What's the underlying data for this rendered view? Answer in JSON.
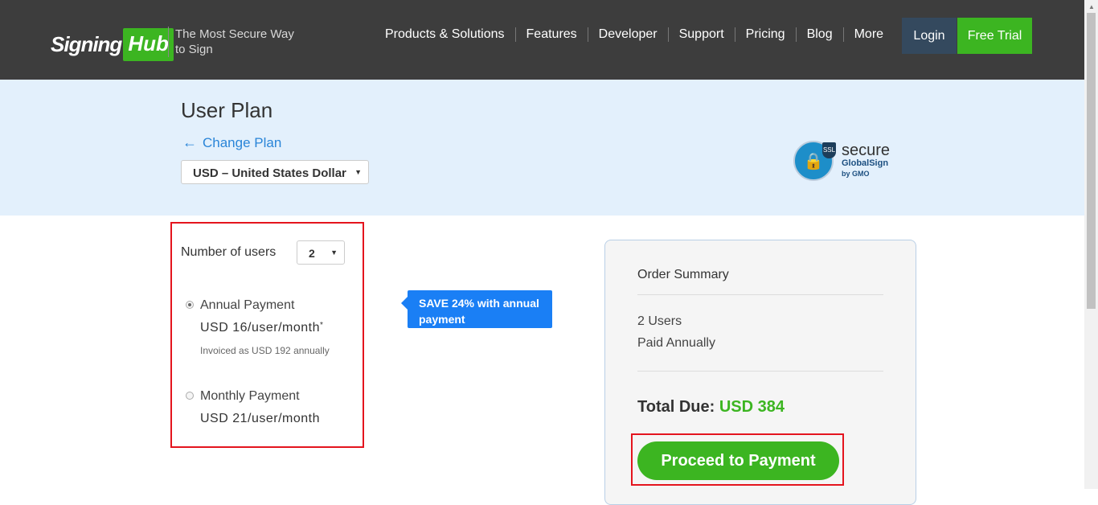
{
  "header": {
    "logo_sign": "Signing",
    "logo_hub": "Hub",
    "tagline": "The Most Secure Way to Sign",
    "nav": [
      "Products & Solutions",
      "Features",
      "Developer",
      "Support",
      "Pricing",
      "Blog",
      "More"
    ],
    "login": "Login",
    "free_trial": "Free Trial"
  },
  "hero": {
    "title": "User Plan",
    "change_plan": "Change Plan",
    "currency": "USD – United States Dollar",
    "ssl": {
      "secure": "secure",
      "brand": "GlobalSign",
      "by": "by GMO",
      "shield": "SSL"
    }
  },
  "plan": {
    "users_label": "Number of users",
    "users_value": "2",
    "annual": {
      "label": "Annual Payment",
      "price": "USD 16/user/month",
      "sup": "*",
      "note": "Invoiced as USD 192 annually",
      "selected": true
    },
    "monthly": {
      "label": "Monthly Payment",
      "price": "USD 21/user/month",
      "selected": false
    },
    "save_tip": "SAVE 24% with annual payment"
  },
  "summary": {
    "title": "Order Summary",
    "users": "2 Users",
    "billing": "Paid Annually",
    "total_label": "Total Due:",
    "total_value": "USD 384",
    "pay_button": "Proceed to Payment"
  },
  "colors": {
    "brand_green": "#3cb521",
    "header_bg": "#3d3d3d",
    "link_blue": "#2a85d8",
    "highlight_red": "#e4141e"
  }
}
